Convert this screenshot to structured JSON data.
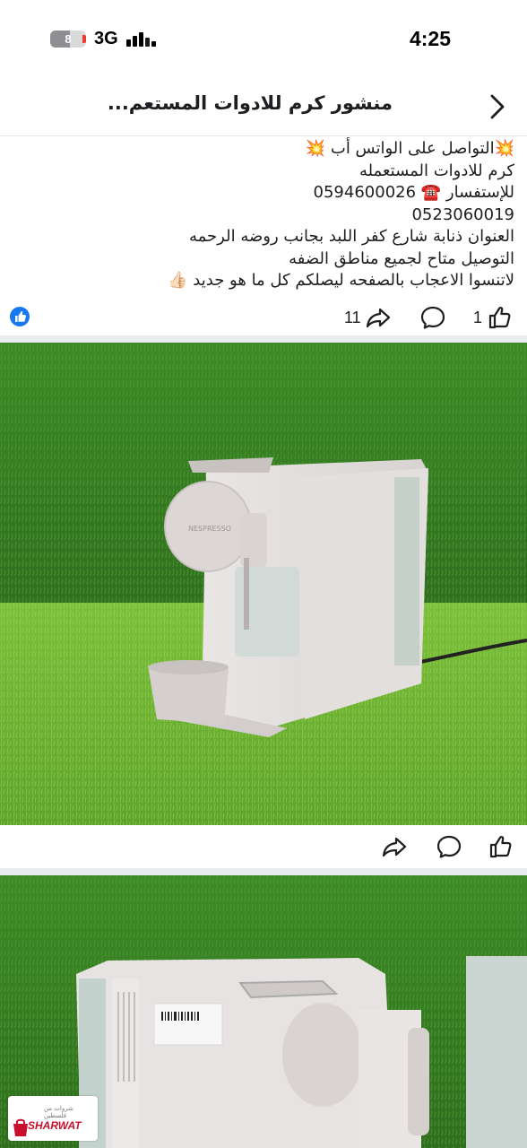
{
  "status_bar": {
    "battery_level": "8",
    "network": "3G",
    "time": "4:25"
  },
  "header": {
    "title": "منشور كرم للادوات المستعم..."
  },
  "post": {
    "lines": [
      "💥التواصل على الواتس أب 💥",
      "كرم للادوات المستعمله",
      "للإستفسار ☎️ 0594600026",
      "0523060019",
      "العنوان ذنابة شارع كفر اللبد بجانب روضه الرحمه",
      "التوصيل متاح لجميع مناطق الضفه",
      "لاتنسوا الاعجاب بالصفحه ليصلكم كل ما هو جديد 👍🏻"
    ],
    "like_count": "1",
    "share_count": "11"
  },
  "photo_product": {
    "brand_mark": "NESPRESSO"
  },
  "watermark": {
    "brand": "SHARWAT",
    "tagline": "شروات من فلسطين"
  },
  "colors": {
    "accent": "#1877f2",
    "grass": "#4f9a2f"
  }
}
